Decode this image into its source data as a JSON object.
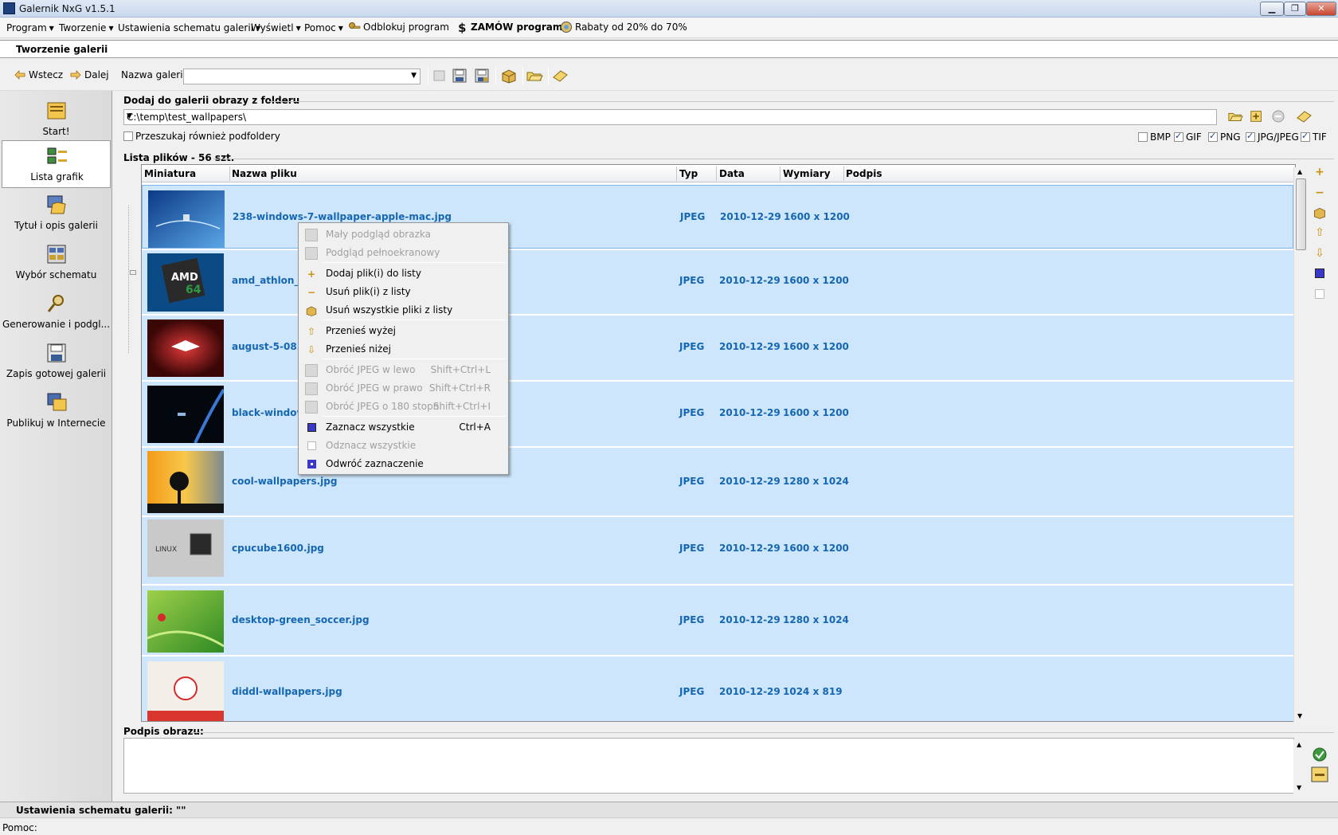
{
  "window": {
    "title": "Galernik NxG v1.5.1",
    "min": "▁",
    "max": "❐",
    "close": "✕"
  },
  "menu": {
    "program": "Program",
    "tworzenie": "Tworzenie",
    "ustawienia": "Ustawienia schematu galerii",
    "wyswietl": "Wyświetl",
    "pomoc": "Pomoc",
    "odblokuj": "Odblokuj program",
    "zamow": "ZAMÓW program!",
    "rabaty": "Rabaty od 20% do 70%",
    "arrow": "▼"
  },
  "section_title": "Tworzenie galerii",
  "toolbar": {
    "back": "Wstecz",
    "next": "Dalej",
    "gallery_name_label": "Nazwa galerii:",
    "gallery_name_value": ""
  },
  "sidebar": {
    "items": [
      {
        "label": "Start!"
      },
      {
        "label": "Lista grafik"
      },
      {
        "label": "Tytuł i opis galerii"
      },
      {
        "label": "Wybór schematu"
      },
      {
        "label": "Generowanie i podgl..."
      },
      {
        "label": "Zapis gotowej galerii"
      },
      {
        "label": "Publikuj w Internecie"
      }
    ]
  },
  "folder": {
    "label": "Dodaj do galerii obrazy z folderu",
    "path": "C:\\temp\\test_wallpapers\\",
    "subfolders_label": "Przeszukaj również podfoldery",
    "formats": [
      "BMP",
      "GIF",
      "PNG",
      "JPG/JPEG",
      "TIF"
    ]
  },
  "list": {
    "title": "Lista plików - 56 szt.",
    "columns": [
      "Miniatura",
      "Nazwa pliku",
      "Typ",
      "Data",
      "Wymiary",
      "Podpis"
    ],
    "rows": [
      {
        "name": "238-windows-7-wallpaper-apple-mac.jpg",
        "type": "JPEG",
        "date": "2010-12-29",
        "dims": "1600 x 1200"
      },
      {
        "name": "amd_athlon_64",
        "type": "JPEG",
        "date": "2010-12-29",
        "dims": "1600 x 1200"
      },
      {
        "name": "august-5-08.jpg",
        "type": "JPEG",
        "date": "2010-12-29",
        "dims": "1600 x 1200"
      },
      {
        "name": "black-windows",
        "type": "JPEG",
        "date": "2010-12-29",
        "dims": "1600 x 1200"
      },
      {
        "name": "cool-wallpapers.jpg",
        "type": "JPEG",
        "date": "2010-12-29",
        "dims": "1280 x 1024"
      },
      {
        "name": "cpucube1600.jpg",
        "type": "JPEG",
        "date": "2010-12-29",
        "dims": "1600 x 1200"
      },
      {
        "name": "desktop-green_soccer.jpg",
        "type": "JPEG",
        "date": "2010-12-29",
        "dims": "1280 x 1024"
      },
      {
        "name": "diddl-wallpapers.jpg",
        "type": "JPEG",
        "date": "2010-12-29",
        "dims": "1024 x 819"
      }
    ]
  },
  "context_menu": {
    "items": [
      {
        "label": "Mały podgląd obrazka",
        "shortcut": ""
      },
      {
        "label": "Podgląd pełnoekranowy",
        "shortcut": ""
      },
      {
        "label": "Dodaj plik(i) do listy",
        "shortcut": ""
      },
      {
        "label": "Usuń plik(i) z listy",
        "shortcut": ""
      },
      {
        "label": "Usuń wszystkie pliki z listy",
        "shortcut": ""
      },
      {
        "label": "Przenieś wyżej",
        "shortcut": ""
      },
      {
        "label": "Przenieś niżej",
        "shortcut": ""
      },
      {
        "label": "Obróć JPEG w lewo",
        "shortcut": "Shift+Ctrl+L"
      },
      {
        "label": "Obróć JPEG w prawo",
        "shortcut": "Shift+Ctrl+R"
      },
      {
        "label": "Obróć JPEG o 180 stopni",
        "shortcut": "Shift+Ctrl+I"
      },
      {
        "label": "Zaznacz wszystkie",
        "shortcut": "Ctrl+A"
      },
      {
        "label": "Odznacz wszystkie",
        "shortcut": ""
      },
      {
        "label": "Odwróć zaznaczenie",
        "shortcut": ""
      }
    ]
  },
  "caption_label": "Podpis obrazu:",
  "status": {
    "scheme": "Ustawienia schematu galerii: \"\"",
    "help": "Pomoc:"
  },
  "colors": {
    "selection": "#cde6fb",
    "text_accent": "#1566b3"
  }
}
